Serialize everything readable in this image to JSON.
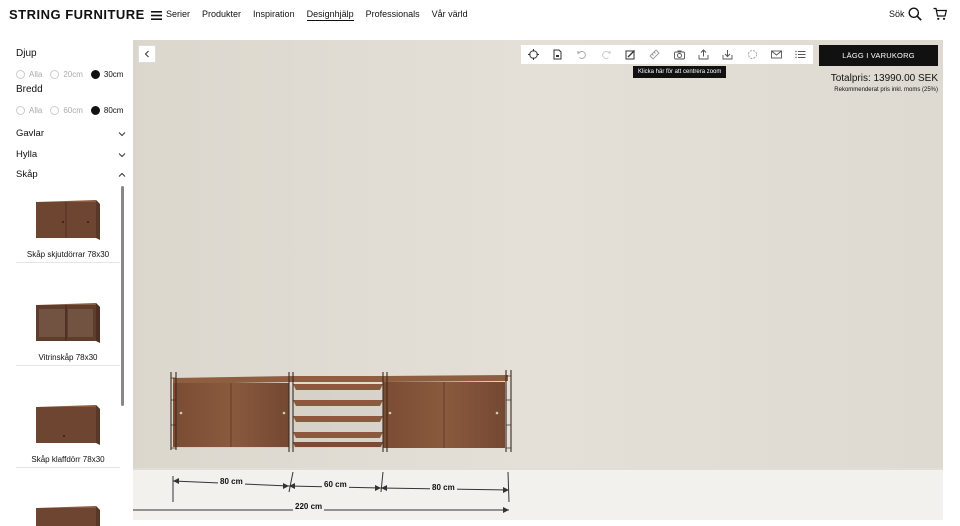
{
  "header": {
    "logo": "STRING FURNITURE",
    "nav": [
      "Serier",
      "Produkter",
      "Inspiration",
      "Designhjälp",
      "Professionals",
      "Vår värld"
    ],
    "active_nav": "Designhjälp",
    "search_label": "Sök",
    "search_icon": "search-icon",
    "cart_icon": "cart-icon"
  },
  "sidebar": {
    "djup": {
      "title": "Djup",
      "options": [
        "Alla",
        "20cm",
        "30cm"
      ],
      "selected": "30cm"
    },
    "bredd": {
      "title": "Bredd",
      "options": [
        "Alla",
        "60cm",
        "80cm"
      ],
      "selected": "80cm"
    },
    "accordions": [
      "Gavlar",
      "Hylla",
      "Skåp"
    ],
    "products": [
      {
        "name": "Skåp skjutdörrar 78x30"
      },
      {
        "name": "Vitrinskåp 78x30"
      },
      {
        "name": "Skåp klaffdörr 78x30"
      }
    ]
  },
  "designer": {
    "tooltip": "Klicka här för att centrera zoom",
    "cta_label": "LÄGG I VARUKORG",
    "total_price": "Totalpris: 13990.00 SEK",
    "vat_note": "Rekommenderat pris inkl. moms (25%)",
    "tools": [
      "target-icon",
      "save-icon",
      "undo-icon",
      "redo-icon",
      "edit-icon",
      "measure-icon",
      "camera-icon",
      "share-icon",
      "download-icon",
      "rotate-icon",
      "email-icon",
      "list-icon"
    ],
    "dimensions": {
      "seg1": "80 cm",
      "seg2": "60 cm",
      "seg3": "80 cm",
      "total": "220 cm"
    }
  },
  "colors": {
    "wall": "#e2ddd4",
    "floor": "#f1f0ec",
    "walnut": "#7a4e34",
    "accent": "#111111"
  }
}
